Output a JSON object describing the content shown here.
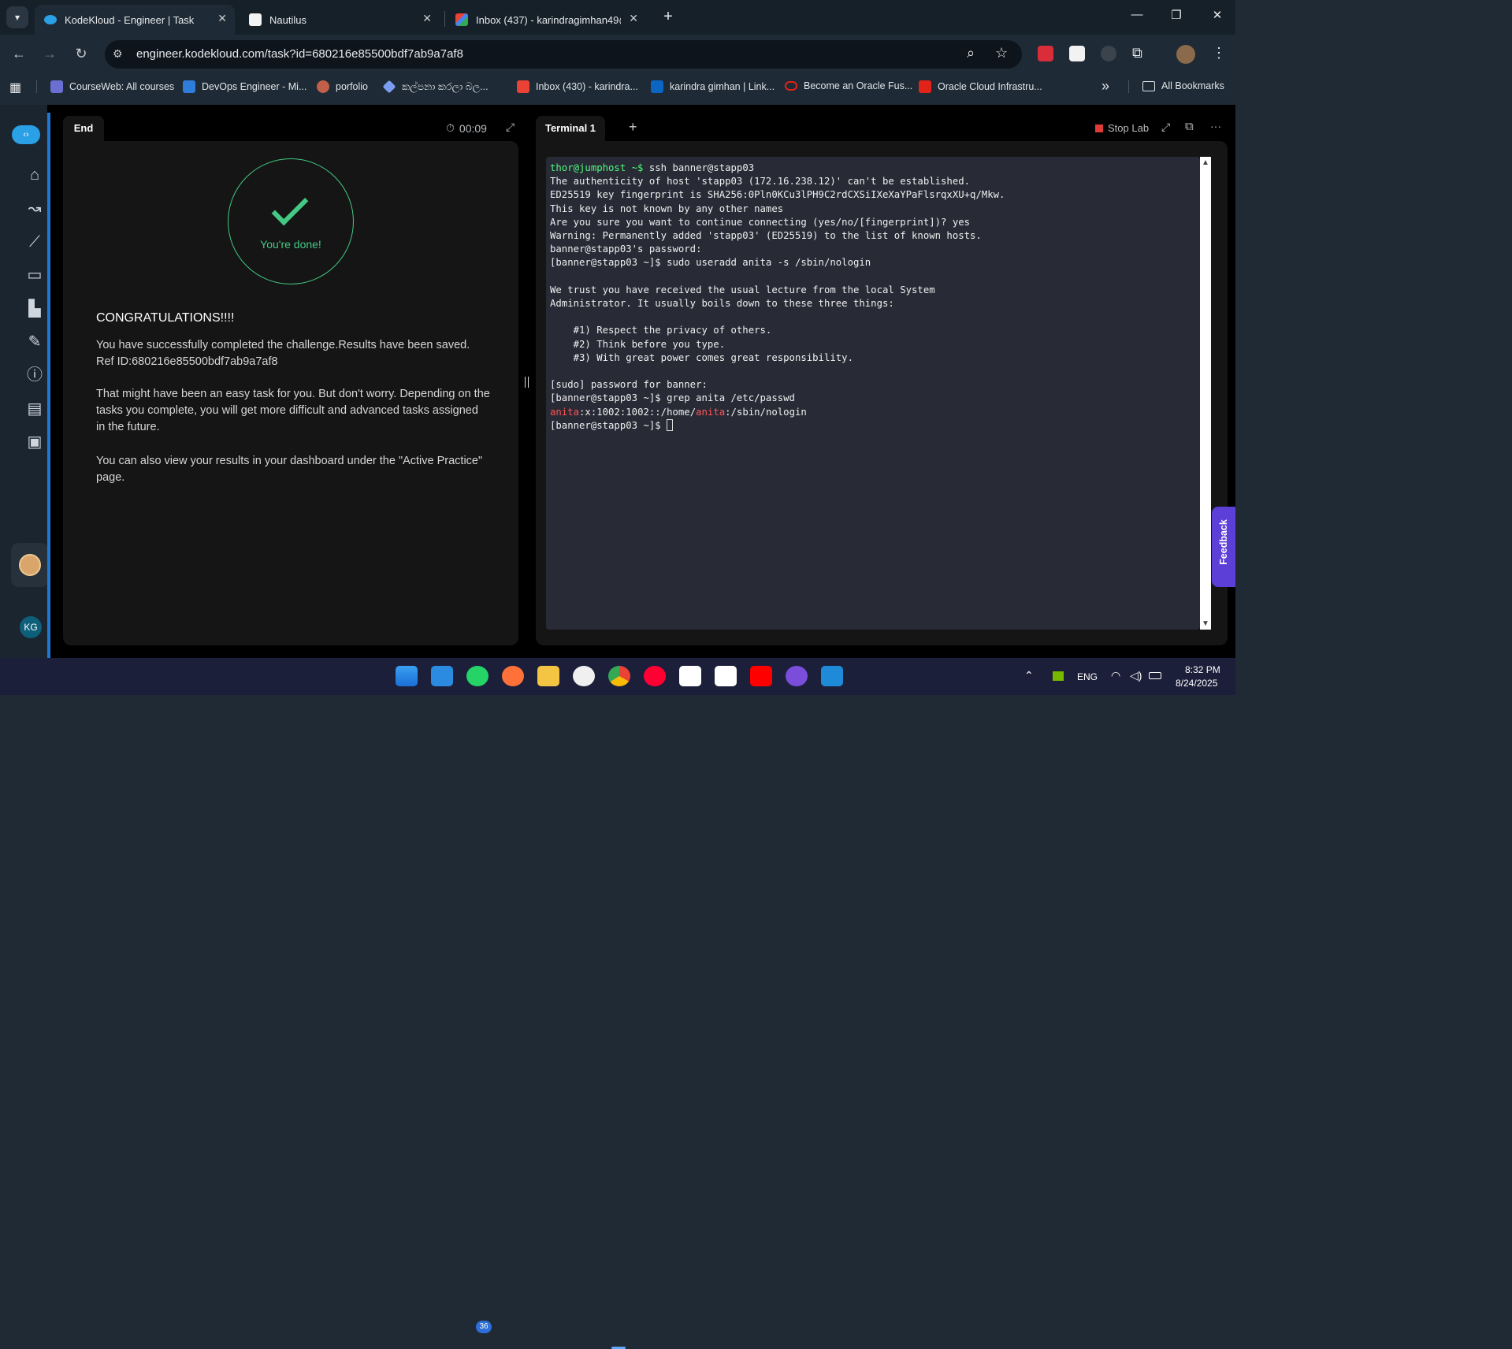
{
  "browser": {
    "tabs": [
      {
        "title": "KodeKloud - Engineer | Task",
        "active": true
      },
      {
        "title": "Nautilus",
        "active": false
      },
      {
        "title": "Inbox (437) - karindragimhan49@g",
        "active": false
      }
    ],
    "new_tab_glyph": "+",
    "url": "engineer.kodekloud.com/task?id=680216e85500bdf7ab9a7af8",
    "bookmarks": [
      {
        "label": "CourseWeb: All courses",
        "icon": "courseweb-icon",
        "color": "#6a6fd1"
      },
      {
        "label": "DevOps Engineer - Mi...",
        "icon": "azure-icon",
        "color": "#2f7ddb"
      },
      {
        "label": "porfolio",
        "icon": "portfolio-icon",
        "color": "#c0604a"
      },
      {
        "label": "කල්පනා කරලා බල...",
        "icon": "gemini-icon",
        "color": "#7b9cf0"
      },
      {
        "label": "Inbox (430) - karindra...",
        "icon": "gmail-icon",
        "color": "#ea4335"
      },
      {
        "label": "karindra gimhan | Link...",
        "icon": "linkedin-icon",
        "color": "#0a66c2"
      },
      {
        "label": "Become an Oracle Fus...",
        "icon": "oracle-icon",
        "color": "#e2231a"
      },
      {
        "label": "Oracle Cloud Infrastru...",
        "icon": "oracle-cloud-icon",
        "color": "#e2231a"
      }
    ],
    "more_glyph": "»",
    "all_bookmarks": "All Bookmarks"
  },
  "left_panel": {
    "tab_label": "End",
    "timer": "00:09",
    "done_text": "You're done!",
    "title": "CONGRATULATIONS!!!!",
    "message_line1": "You have successfully completed the challenge.Results have been saved.",
    "message_line2": "Ref ID:680216e85500bdf7ab9a7af8",
    "paragraph2": "That might have been an easy task for you. But don't worry. Depending on the tasks you complete, you will get more difficult and advanced tasks assigned in the future.",
    "paragraph3": "You can also view your results in your dashboard under the \"Active Practice\" page."
  },
  "terminal": {
    "tab_label": "Terminal 1",
    "add_glyph": "+",
    "stop_lab": "Stop Lab",
    "more_glyph": "···",
    "prompt1": "thor@jumphost ~$",
    "cmd1": " ssh banner@stapp03",
    "lines_a": [
      "The authenticity of host 'stapp03 (172.16.238.12)' can't be established.",
      "ED25519 key fingerprint is SHA256:0Pln0KCu3lPH9C2rdCXSiIXeXaYPaFlsrqxXU+q/Mkw.",
      "This key is not known by any other names",
      "Are you sure you want to continue connecting (yes/no/[fingerprint])? yes",
      "Warning: Permanently added 'stapp03' (ED25519) to the list of known hosts.",
      "banner@stapp03's password:",
      "[banner@stapp03 ~]$ sudo useradd anita -s /sbin/nologin",
      "",
      "We trust you have received the usual lecture from the local System",
      "Administrator. It usually boils down to these three things:",
      "",
      "    #1) Respect the privacy of others.",
      "    #2) Think before you type.",
      "    #3) With great power comes great responsibility.",
      "",
      "[sudo] password for banner:",
      "[banner@stapp03 ~]$ grep anita /etc/passwd"
    ],
    "passwd_user": "anita",
    "passwd_mid": ":x:1002:1002::/home/",
    "passwd_home_user": "anita",
    "passwd_tail": ":/sbin/nologin",
    "last_prompt": "[banner@stapp03 ~]$ "
  },
  "sidebar": {
    "items": [
      "home-icon",
      "roadmap-icon",
      "growth-icon",
      "video-icon",
      "leaderboard-icon",
      "blog-icon",
      "info-icon",
      "docs-icon",
      "forum-icon"
    ],
    "user_initials": "KG"
  },
  "feedback_label": "Feedback",
  "taskbar": {
    "whatsapp_badge": "36",
    "language": "ENG",
    "time": "8:32 PM",
    "date": "8/24/2025"
  },
  "colors": {
    "success": "#43c984",
    "terminal_bg": "#282a36",
    "accent": "#1f77d6",
    "feedback": "#5b3fd6"
  }
}
